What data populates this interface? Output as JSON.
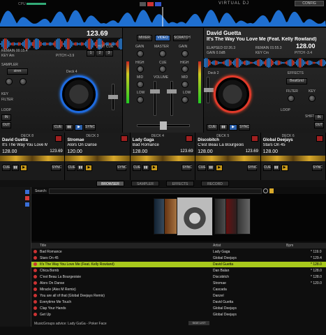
{
  "topbar": {
    "cpu_label": "CPU",
    "brand": "VIRTUAL DJ",
    "config": "CONFIG"
  },
  "deckL": {
    "title": "",
    "bpm": "123.69",
    "hot_cue": "HOT CUE",
    "remain": "REMAIN 00:15.4",
    "key": "KEY Am",
    "pitch": "PITCH +3.9",
    "deck_label": "Deck 4",
    "sampler": "SAMPLER",
    "keyctrl": "KEY",
    "filter": "FILTER",
    "loop": "LOOP",
    "in": "IN",
    "out": "OUT",
    "cue": "CUE",
    "sync": "SYNC"
  },
  "deckR": {
    "artist": "David Guetta",
    "title": "It's The Way You Love Me (Feat. Kelly Rowland)",
    "bpm": "128.00",
    "elapsed": "ELAPSED 02:26.3",
    "gain": "GAIN 0.0dB",
    "remain": "REMAIN 01:55.3",
    "key": "KEY Cm",
    "pitch": "PITCH -3.4",
    "deck_label": "Deck 2",
    "effects": "EFFECTS",
    "effect_sel": "BeatGrid",
    "filter": "FILTER",
    "keyctrl": "KEY",
    "loop": "LOOP",
    "shift": "SHIFT",
    "in": "IN",
    "out": "OUT",
    "cue": "CUE",
    "sync": "SYNC"
  },
  "mixer": {
    "tabs": [
      "MIXER",
      "VIDEO",
      "SCRATCH"
    ],
    "labels": [
      "GAIN",
      "MASTER",
      "GAIN",
      "HIGH",
      "CUE",
      "HIGH",
      "MID",
      "VOLUME",
      "MID",
      "LOW",
      "LOW"
    ]
  },
  "mini": [
    {
      "deck": "DECK 8",
      "artist": "David Guetta",
      "title": "It's The Way You Love Me",
      "bpm": "128.00",
      "tbpm": "123.69"
    },
    {
      "deck": "DECK 3",
      "artist": "Stromae",
      "title": "Alors On Danse",
      "bpm": "120.00",
      "tbpm": ""
    },
    {
      "deck": "DECK 4",
      "artist": "Lady Gaga",
      "title": "Bad Romance",
      "bpm": "128.00",
      "tbpm": "123.69"
    },
    {
      "deck": "DECK 5",
      "artist": "Discobitch",
      "title": "C'est Beau La Bourgeoisie",
      "bpm": "128.00",
      "tbpm": "123.69"
    },
    {
      "deck": "DECK 6",
      "artist": "Global Deejays",
      "title": "Stars On 45",
      "bpm": "128.00",
      "tbpm": ""
    }
  ],
  "browser_tabs": [
    "BROWSER",
    "SAMPLER",
    "EFFECTS",
    "RECORD"
  ],
  "search": {
    "label": "Search:",
    "value": ""
  },
  "table": {
    "headers": [
      "Title",
      "Artist",
      "Bpm"
    ],
    "rows": [
      {
        "title": "Bad Romance",
        "artist": "Lady Gaga",
        "bpm": "* 119.0"
      },
      {
        "title": "Stars On 45",
        "artist": "Global Deejays",
        "bpm": "* 129.4"
      },
      {
        "title": "It's The Way You Love Me (Feat. Kelly Rowland)",
        "artist": "David Guetta",
        "bpm": "* 128.0"
      },
      {
        "title": "Chica Bomb",
        "artist": "Dan Balan",
        "bpm": "* 128.0"
      },
      {
        "title": "C'est Beau La Bourgeoisie",
        "artist": "Discobitch",
        "bpm": "* 128.0"
      },
      {
        "title": "Alors On Danse",
        "artist": "Stromae",
        "bpm": "* 120.0"
      },
      {
        "title": "Miracle (Alex M Remix)",
        "artist": "Cascada",
        "bpm": ""
      },
      {
        "title": "You are all of that (Global Deejays Remix)",
        "artist": "Danzel",
        "bpm": ""
      },
      {
        "title": "Everytime Me Touch",
        "artist": "David Guetta",
        "bpm": ""
      },
      {
        "title": "Clap Your Hands",
        "artist": "Global Deejays",
        "bpm": ""
      },
      {
        "title": "Get Up",
        "artist": "Global Deejays",
        "bpm": ""
      }
    ],
    "selected_index": 2
  },
  "status": {
    "text": "MusicGroups advice: Lady GaGa - Poker Face",
    "sidelist": "SIDE LIST"
  },
  "colors": {
    "accent_blue": "#2a82ff",
    "accent_red": "#e03a2a",
    "selection": "#a7c81c",
    "wave": "#2a7fd8"
  }
}
